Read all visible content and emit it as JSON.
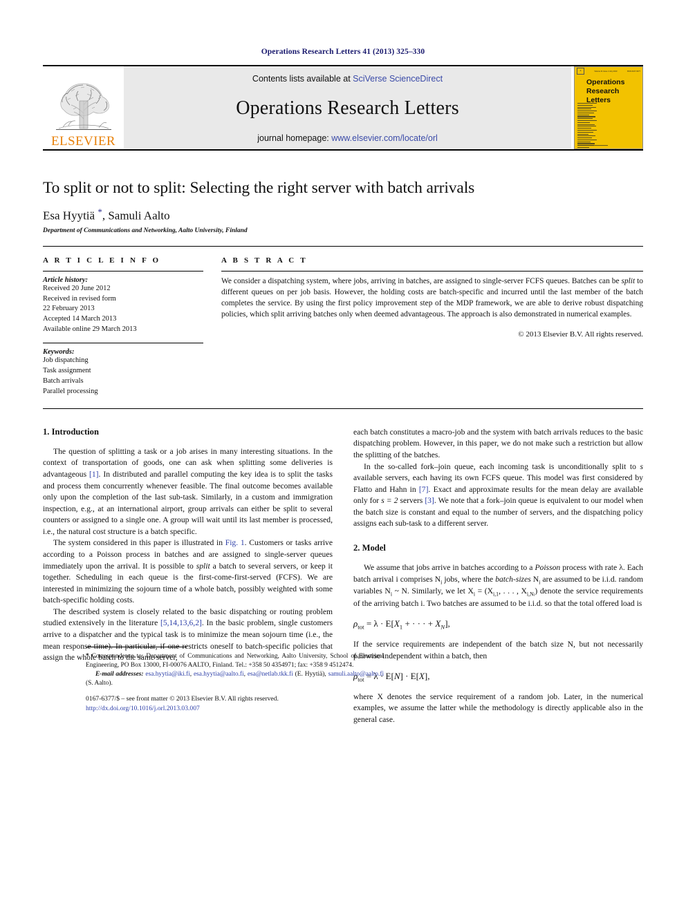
{
  "running_head": "Operations Research Letters 41 (2013) 325–330",
  "masthead": {
    "publisher_name": "ELSEVIER",
    "contents_prefix": "Contents lists available at ",
    "contents_link": "SciVerse ScienceDirect",
    "journal_name": "Operations Research Letters",
    "homepage_prefix": "journal homepage: ",
    "homepage_link": "www.elsevier.com/locate/orl",
    "cover": {
      "title_line1": "Operations",
      "title_line2": "Research",
      "title_line3": "Letters",
      "top_left": "ELSEVIER",
      "top_center": "Volume 41 Issue 4 July 2013",
      "top_right": "ISSN 0167-6377",
      "background_color": "#F2C200"
    }
  },
  "article": {
    "title": "To split or not to split: Selecting the right server with batch arrivals",
    "authors": "Esa Hyytiä ",
    "author_star": "*",
    "authors_rest": ", Samuli Aalto",
    "affiliation": "Department of Communications and Networking, Aalto University, Finland"
  },
  "article_info": {
    "heading": "A R T I C L E   I N F O",
    "history_label": "Article history:",
    "history": [
      "Received 20 June 2012",
      "Received in revised form",
      "22 February 2013",
      "Accepted 14 March 2013",
      "Available online 29 March 2013"
    ],
    "keywords_label": "Keywords:",
    "keywords": [
      "Job dispatching",
      "Task assignment",
      "Batch arrivals",
      "Parallel processing"
    ]
  },
  "abstract": {
    "heading": "A B S T R A C T",
    "text_part1": "We consider a dispatching system, where jobs, arriving in batches, are assigned to single-server FCFS queues. Batches can be ",
    "split_word": "split",
    "text_part2": " to different queues on per job basis. However, the holding costs are batch-specific and incurred until the last member of the batch completes the service. By using the first policy improvement step of the MDP framework, we are able to derive robust dispatching policies, which split arriving batches only when deemed advantageous. The approach is also demonstrated in numerical examples.",
    "copyright": "© 2013 Elsevier B.V. All rights reserved."
  },
  "sections": {
    "introduction": {
      "heading": "1. Introduction",
      "p1_a": "The question of splitting a task or a job arises in many interesting situations. In the context of transportation of goods, one can ask when splitting some deliveries is advantageous ",
      "p1_ref": "[1]",
      "p1_b": ". In distributed and parallel computing the key idea is to split the tasks and process them concurrently whenever feasible. The final outcome becomes available only upon the completion of the last sub-task. Similarly, in a custom and immigration inspection, e.g., at an international airport, group arrivals can either be split to several counters or assigned to a single one. A group will wait until its last member is processed, i.e., the natural cost structure is a batch specific.",
      "p2_a": "The system considered in this paper is illustrated in ",
      "p2_ref": "Fig. 1",
      "p2_b": ". Customers or tasks arrive according to a Poisson process in batches and are assigned to single-server queues immediately upon the arrival. It is possible to ",
      "p2_em": "split",
      "p2_c": " a batch to several servers, or keep it together. Scheduling in each queue is the first-come-first-served (FCFS). We are interested in minimizing the sojourn time of a whole batch, possibly weighted with some batch-specific holding costs.",
      "p3_a": "The described system is closely related to the basic dispatching or routing problem studied extensively in the literature ",
      "p3_ref": "[5,14,13,6,2]",
      "p3_b": ". In the basic problem, single customers arrive to a dispatcher and the typical task is to minimize the mean sojourn time (i.e., the mean response time). In particular, if one restricts oneself to batch-specific policies that assign the whole batch to the same server,",
      "p4_a": "each batch constitutes a macro-job and the system with batch arrivals reduces to the basic dispatching problem. However, in this paper, we do not make such a restriction but allow the splitting of the batches.",
      "p5_a": "In the so-called fork–join queue, each incoming task is unconditionally split to ",
      "p5_s1": "s",
      "p5_b": " available servers, each having its own FCFS queue. This model was first considered by Flatto and Hahn in ",
      "p5_ref1": "[7]",
      "p5_c": ". Exact and approximate results for the mean delay are available only for ",
      "p5_math": "s = 2",
      "p5_d": " servers ",
      "p5_ref2": "[3]",
      "p5_e": ". We note that a fork–join queue is equivalent to our model when the batch size is constant and equal to the number of servers, and the dispatching policy assigns each sub-task to a different server."
    },
    "model": {
      "heading": "2. Model",
      "p1_a": "We assume that jobs arrive in batches according to a ",
      "p1_em1": "Poisson",
      "p1_b": " process with rate λ. Each batch arrival i comprises N",
      "p1_sub1": "i",
      "p1_c": " jobs, where the ",
      "p1_em2": "batch-sizes",
      "p1_d": " N",
      "p1_sub2": "i",
      "p1_e": " are assumed to be i.i.d. random variables N",
      "p1_sub3": "i",
      "p1_f": " ~ N. Similarly, we let X",
      "p1_sub4": "i",
      "p1_g": "   =   (X",
      "p1_sub5": "i,1",
      "p1_h": ", . . . , X",
      "p1_sub6": "i,N",
      "p1_sub6b": "i",
      "p1_i": ") denote the service requirements of the arriving batch i. Two batches are assumed to be i.i.d. so that the total offered load is",
      "formula1": "ρtot = λ · E[X1 + · · · + XN],",
      "p2": "If the service requirements are independent of the batch size N, but not necessarily pairwise independent within a batch, then",
      "formula2": "ρtot = λ · E[N] · E[X],",
      "p3": "where X denotes the service requirement of a random job. Later, in the numerical examples, we assume the latter while the methodology is directly applicable also in the general case."
    }
  },
  "footnote": {
    "star": "*",
    "correspondence": " Correspondence to: Department of Communications and Networking, Aalto University, School of Electrical Engineering, PO Box 13000, FI-00076 AALTO, Finland. Tel.: +358 50 4354971; fax: +358 9 4512474.",
    "email_label": "E-mail addresses:",
    "email1": "esa.hyytia@iki.fi",
    "email2": "esa.hyytia@aalto.fi",
    "email3": "esa@netlab.tkk.fi",
    "email1_owner": "(E. Hyytiä), ",
    "email4": "samuli.aalto@aalto.fi",
    "email4_owner": " (S. Aalto)."
  },
  "footer": {
    "issn_line": "0167-6377/$ – see front matter © 2013 Elsevier B.V. All rights reserved.",
    "doi": "http://dx.doi.org/10.1016/j.orl.2013.03.007"
  }
}
